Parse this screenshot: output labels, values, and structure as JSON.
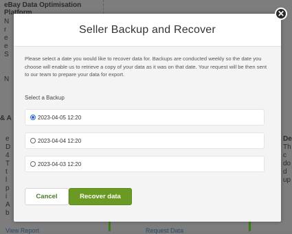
{
  "background": {
    "left_title": "eBay Data Optimisation Platform",
    "left_fragments": [
      "N",
      "r",
      "e",
      "e",
      "S",
      "N"
    ],
    "amp_fragment": "& A",
    "left_col2": [
      "e",
      "D",
      "4",
      "T",
      "t",
      "l",
      "p",
      "i",
      "A",
      "b"
    ],
    "right_letters": [
      "De",
      "Th",
      "c",
      "do",
      "d",
      "up"
    ],
    "link_left": "View Report",
    "link_mid": "Request Data"
  },
  "modal": {
    "title": "Seller Backup and Recover",
    "description": "Please select a date you would like to recover data for. Backups are conducted weekly so the date you choose will enable us to retrieve a copy of your data as it was on that date. Your request will be then sent to our team to prepare your data for export.",
    "section_label": "Select a Backup",
    "options": [
      {
        "label": "2023-04-05 12:20",
        "selected": true
      },
      {
        "label": "2023-04-04 12:20",
        "selected": false
      },
      {
        "label": "2023-04-03 12:20",
        "selected": false
      }
    ],
    "cancel_label": "Cancel",
    "recover_label": "Recover data",
    "close_icon": "close-icon"
  },
  "colors": {
    "overlay": "#7d7d7d",
    "primary": "#6a9a23",
    "cancel_text": "#4a7a2a",
    "radio_selected": "#2f66d0"
  }
}
